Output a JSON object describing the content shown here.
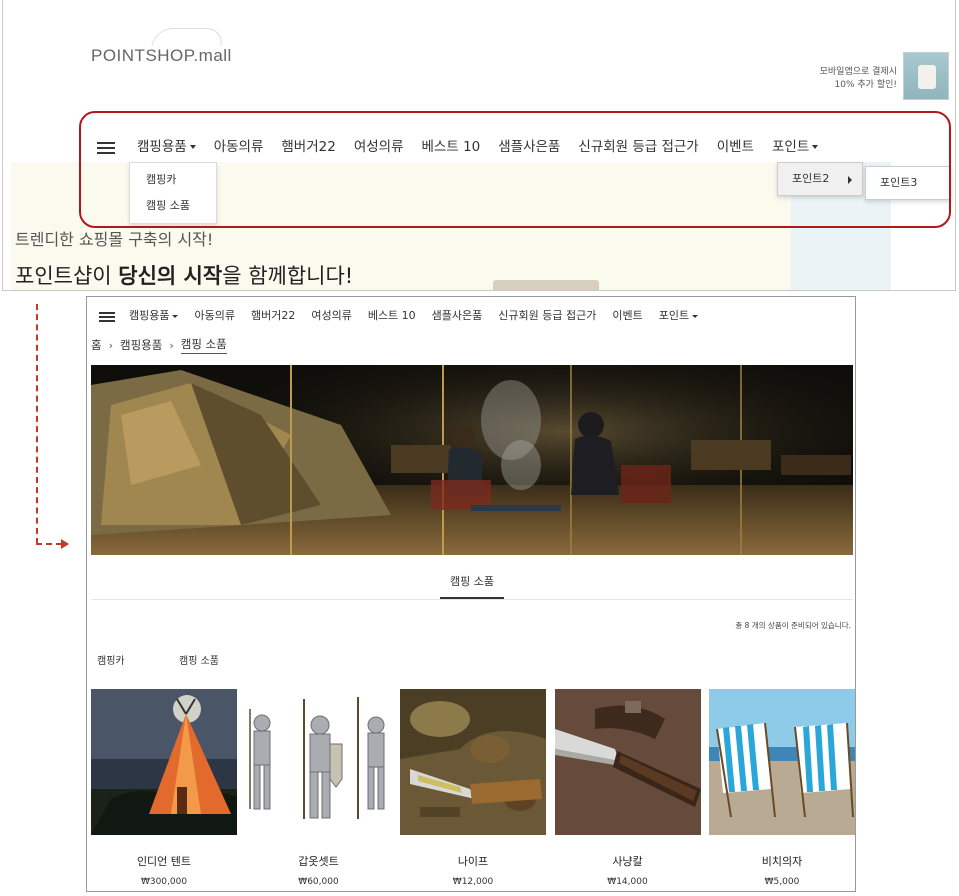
{
  "top": {
    "logo": "POINTSHOP.mall",
    "promo_line1": "모바일앱으로 결제시",
    "promo_line2": "10% 추가 할인!",
    "nav": [
      "캠핑용품",
      "아동의류",
      "햄버거22",
      "여성의류",
      "베스트 10",
      "샘플사은품",
      "신규회원 등급 접근가",
      "이벤트",
      "포인트"
    ],
    "dropdown_camping": [
      "캠핑카",
      "캠핑 소품"
    ],
    "dropdown_point_l2": "포인트2",
    "dropdown_point_l3": "포인트3",
    "hero_line1": "트렌디한 쇼핑몰 구축의 시작!",
    "hero_line2_a": "포인트샵이 ",
    "hero_line2_b": "당신의 시작",
    "hero_line2_c": "을 함께합니다!"
  },
  "bottom": {
    "nav": [
      "캠핑용품",
      "아동의류",
      "햄버거22",
      "여성의류",
      "베스트 10",
      "샘플사은품",
      "신규회원 등급 접근가",
      "이벤트",
      "포인트"
    ],
    "breadcrumb": {
      "home": "홈",
      "sep": "›",
      "parent": "캠핑용품",
      "current": "캠핑 소품"
    },
    "category_tab": "캠핑 소품",
    "product_count_text": "총 8 개의 상품이 준비되어 있습니다.",
    "sub_categories": [
      "캠핑카",
      "캠핑 소품"
    ],
    "products": [
      {
        "name": "인디언 텐트",
        "price": "₩300,000"
      },
      {
        "name": "갑옷셋트",
        "price": "₩60,000"
      },
      {
        "name": "나이프",
        "price": "₩12,000"
      },
      {
        "name": "사냥칼",
        "price": "₩14,000"
      },
      {
        "name": "비치의자",
        "price": "₩5,000"
      }
    ]
  },
  "colors": {
    "highlight": "#b4161b",
    "arrow": "#c0392b"
  }
}
